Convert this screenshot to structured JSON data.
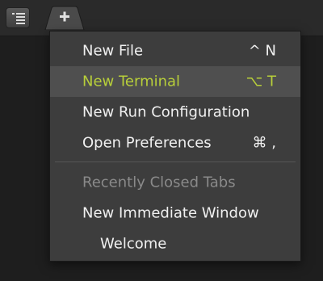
{
  "toolbar": {
    "menu_icon": "menu-list-icon",
    "add_icon": "plus-icon"
  },
  "menu": {
    "items": [
      {
        "label": "New File",
        "shortcut": "^ N"
      },
      {
        "label": "New Terminal",
        "shortcut": "⌥ T"
      },
      {
        "label": "New Run Configuration",
        "shortcut": ""
      },
      {
        "label": "Open Preferences",
        "shortcut": "⌘ ,"
      },
      {
        "label": "Recently Closed Tabs",
        "shortcut": ""
      },
      {
        "label": "New Immediate Window",
        "shortcut": ""
      },
      {
        "label": "Welcome",
        "shortcut": ""
      }
    ]
  },
  "colors": {
    "highlight_text": "#b8cf3a",
    "menu_bg": "#3d3d3d",
    "highlight_bg": "#4f4f4f"
  }
}
